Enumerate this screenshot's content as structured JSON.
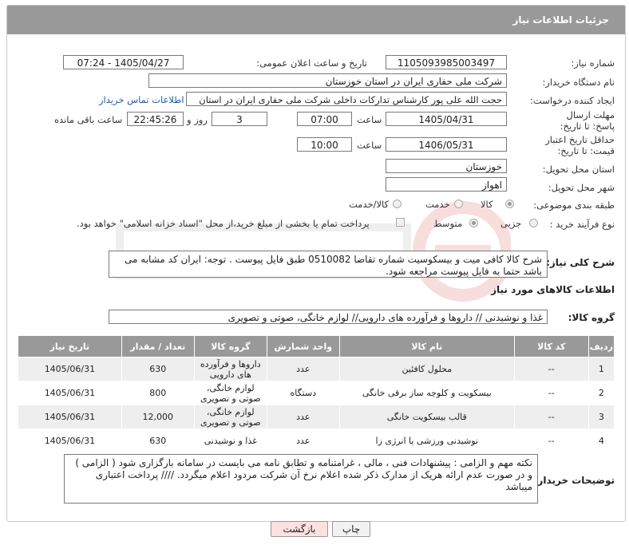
{
  "header": {
    "title": "جزئیات اطلاعات نیاز"
  },
  "labels": {
    "need_number": "شماره نیاز:",
    "announce_datetime": "تاریخ و ساعت اعلان عمومی:",
    "buyer_org": "نام دستگاه خریدار:",
    "requester": "ایجاد کننده درخواست:",
    "send_deadline": "مهلت ارسال پاسخ: تا تاریخ:",
    "price_validity": "حداقل تاریخ اعتبار قیمت: تا تاریخ:",
    "province": "استان محل تحویل:",
    "city": "شهر محل تحویل:",
    "category": "طبقه بندی موضوعی:",
    "process_type": "نوع فرآیند خرید :",
    "time_word": "ساعت",
    "day_word": "روز و",
    "remaining": "ساعت باقی مانده",
    "general_desc": "شرح کلی نیاز:",
    "goods_info": "اطلاعات کالاهای مورد نیاز",
    "goods_group": "گروه کالا:",
    "buyer_notes": "توضیحات خریدار:"
  },
  "values": {
    "need_number": "1105093985003497",
    "announce_datetime": "1405/04/27 - 07:24",
    "buyer_org": "شرکت ملی حفاری ایران در استان خوزستان",
    "requester": "حجت الله علی پور کارشناس تدارکات داخلی شرکت ملی حفاری ایران در استان",
    "contact_link": "اطلاعات تماس خریدار",
    "send_date": "1405/04/31",
    "send_time": "07:00",
    "days": "3",
    "remaining_time": "22:45:26",
    "validity_date": "1406/05/31",
    "validity_time": "10:00",
    "province": "خوزستان",
    "city": "اهواز",
    "general_desc": "شرح کالا کافی میت و بیسکوسیت شماره تقاضا 0510082 طبق فایل پیوست . توجه: ایران کد مشابه می باشد حتما به فایل پیوست مراجعه شود.",
    "goods_group": "غذا و نوشیدنی // داروها و فرآورده های دارویی// لوازم خانگی، صوتی و تصویری",
    "buyer_notes": "نکته مهم و الزامی : پیشنهادات فنی ، مالی ، غرامتنامه و تطابق نامه می بایست در سامانه بارگزاری شود ( الزامی ) و در صورت عدم ارائه هریک از مدارک ذکر شده اعلام نرخ آن شرکت مردود اعلام میگردد.  //// پرداخت اعتباری میباشد"
  },
  "category_options": [
    {
      "label": "کالا",
      "selected": true
    },
    {
      "label": "خدمت",
      "selected": false
    },
    {
      "label": "کالا/خدمت",
      "selected": false
    }
  ],
  "process_options": [
    {
      "label": "جزیی",
      "selected": false
    },
    {
      "label": "متوسط",
      "selected": true
    }
  ],
  "payment_note": "پرداخت تمام یا بخشی از مبلغ خرید،از محل \"اسناد خزانه اسلامی\" خواهد بود.",
  "table": {
    "headers": [
      "ردیف",
      "کد کالا",
      "نام کالا",
      "واحد شمارش",
      "گروه کالا",
      "تعداد / مقدار",
      "تاریخ نیاز"
    ],
    "rows": [
      {
        "row": "1",
        "code": "--",
        "name": "محلول کافئین",
        "unit": "عدد",
        "group": "داروها و فرآورده های دارویی",
        "qty": "630",
        "date": "1405/06/31"
      },
      {
        "row": "2",
        "code": "--",
        "name": "بیسکویت و کلوچه ساز برقی خانگی",
        "unit": "دستگاه",
        "group": "لوازم خانگی، صوتی و تصویری",
        "qty": "800",
        "date": "1405/06/31"
      },
      {
        "row": "3",
        "code": "--",
        "name": "قالب بیسکویت خانگی",
        "unit": "عدد",
        "group": "لوازم خانگی، صوتی و تصویری",
        "qty": "12,000",
        "date": "1405/06/31"
      },
      {
        "row": "4",
        "code": "--",
        "name": "نوشیدنی ورزشی یا انرژی زا",
        "unit": "عدد",
        "group": "غذا و نوشیدنی",
        "qty": "630",
        "date": "1405/06/31"
      }
    ]
  },
  "buttons": {
    "print": "چاپ",
    "back": "بازگشت"
  },
  "colors": {
    "header_bg": "#999999",
    "back_button_bg": "#fde0e0",
    "link": "#1a5fb4"
  }
}
